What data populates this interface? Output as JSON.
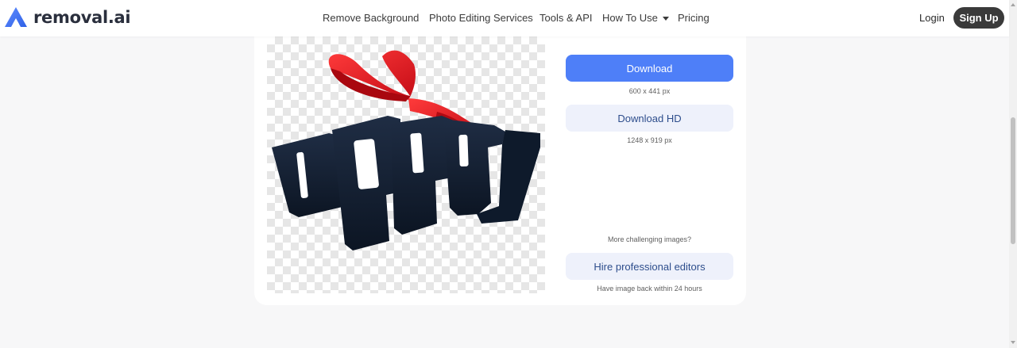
{
  "brand": {
    "name": "removal.ai",
    "accent": "#4e7ff8"
  },
  "nav": {
    "items": [
      "Remove Background",
      "Photo Editing Services",
      "Tools & API",
      "How To Use",
      "Pricing"
    ],
    "login": "Login",
    "signup": "Sign Up"
  },
  "result": {
    "download_label": "Download",
    "download_size": "600 x 441 px",
    "download_hd_label": "Download HD",
    "download_hd_size": "1248 x 919 px",
    "more_challenging": "More challenging images?",
    "hire_label": "Hire professional editors",
    "hire_note": "Have image back within 24 hours"
  },
  "icons": {
    "logo": "removal-ai-logo-icon",
    "caret": "chevron-down-icon"
  }
}
